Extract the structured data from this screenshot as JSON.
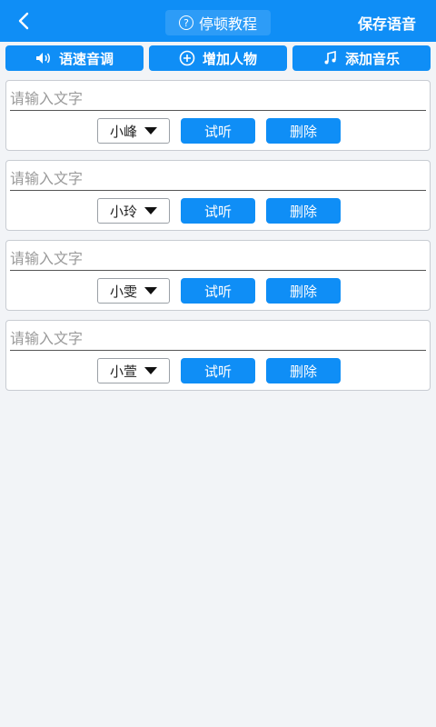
{
  "colors": {
    "accent": "#0f8ef6",
    "background": "#f2f4f7"
  },
  "header": {
    "back_icon": "chevron-left-icon",
    "help_label": "停顿教程",
    "help_icon": "question-circle-icon",
    "save_label": "保存语音"
  },
  "toolbar": {
    "speed_label": "语速音调",
    "speed_icon": "speaker-icon",
    "add_person_label": "增加人物",
    "add_person_icon": "plus-circle-icon",
    "add_music_label": "添加音乐",
    "add_music_icon": "music-note-icon"
  },
  "items": [
    {
      "placeholder": "请输入文字",
      "voice": "小峰",
      "listen_label": "试听",
      "delete_label": "删除"
    },
    {
      "placeholder": "请输入文字",
      "voice": "小玲",
      "listen_label": "试听",
      "delete_label": "删除"
    },
    {
      "placeholder": "请输入文字",
      "voice": "小雯",
      "listen_label": "试听",
      "delete_label": "删除"
    },
    {
      "placeholder": "请输入文字",
      "voice": "小萱",
      "listen_label": "试听",
      "delete_label": "删除"
    }
  ]
}
